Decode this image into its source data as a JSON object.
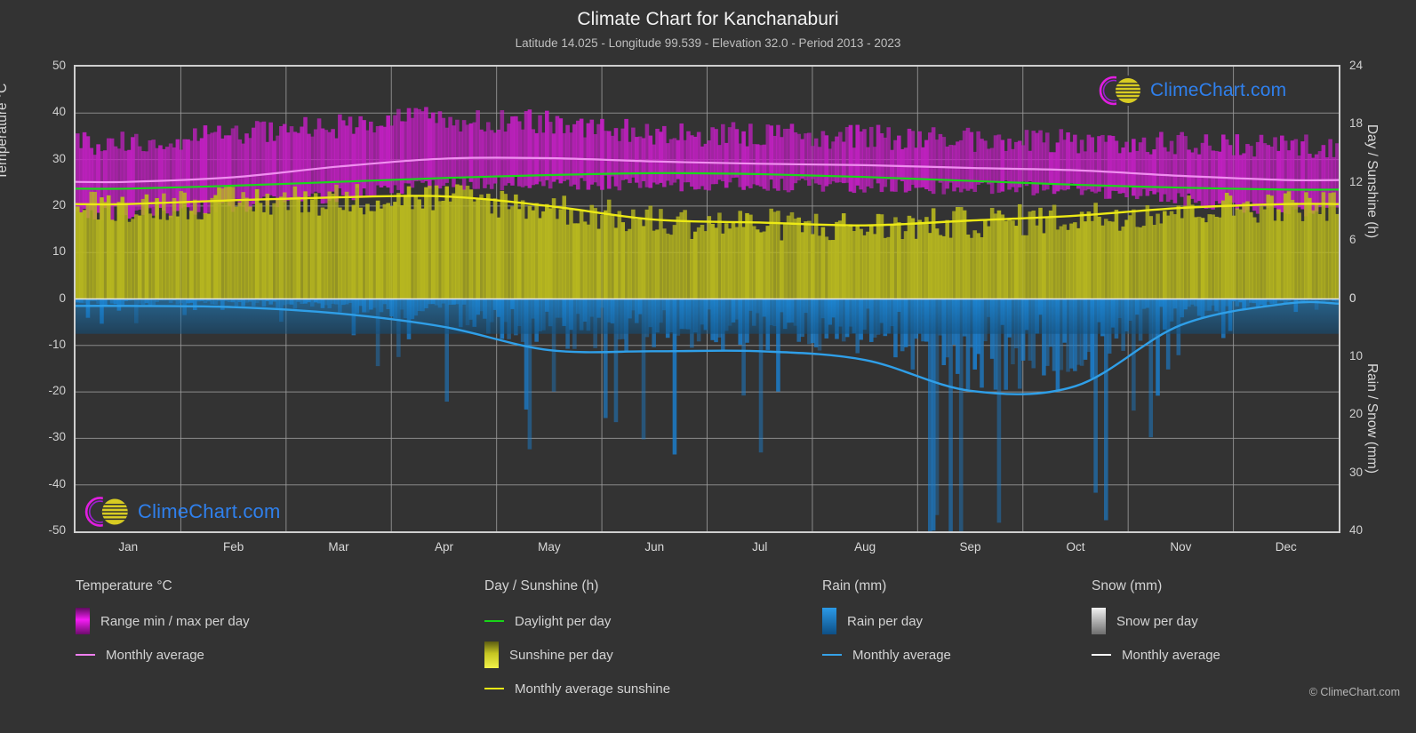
{
  "header": {
    "title": "Climate Chart for Kanchanaburi",
    "subtitle": "Latitude 14.025 - Longitude 99.539 - Elevation 32.0 - Period 2013 - 2023"
  },
  "axes": {
    "y_left_title": "Temperature °C",
    "y_right_top_title": "Day / Sunshine (h)",
    "y_right_bottom_title": "Rain / Snow (mm)",
    "y_left_ticks": [
      "50",
      "40",
      "30",
      "20",
      "10",
      "0",
      "-10",
      "-20",
      "-30",
      "-40",
      "-50"
    ],
    "y_right_top_ticks": [
      "24",
      "18",
      "12",
      "6",
      "0"
    ],
    "y_right_bottom_ticks": [
      "0",
      "10",
      "20",
      "30",
      "40"
    ],
    "x_ticks": [
      "Jan",
      "Feb",
      "Mar",
      "Apr",
      "May",
      "Jun",
      "Jul",
      "Aug",
      "Sep",
      "Oct",
      "Nov",
      "Dec"
    ]
  },
  "legend": {
    "temperature": {
      "heading": "Temperature °C",
      "items": [
        {
          "label": "Range min / max per day",
          "marker": "gradient-swatch",
          "color": "#c020c0"
        },
        {
          "label": "Monthly average",
          "marker": "line",
          "color": "#ef7fef"
        }
      ]
    },
    "day_sunshine": {
      "heading": "Day / Sunshine (h)",
      "items": [
        {
          "label": "Daylight per day",
          "marker": "line",
          "color": "#18d418"
        },
        {
          "label": "Sunshine per day",
          "marker": "gradient-swatch",
          "color": "#b8b820"
        },
        {
          "label": "Monthly average sunshine",
          "marker": "line",
          "color": "#e8e815"
        }
      ]
    },
    "rain": {
      "heading": "Rain (mm)",
      "items": [
        {
          "label": "Rain per day",
          "marker": "gradient-swatch",
          "color": "#1484d6"
        },
        {
          "label": "Monthly average",
          "marker": "line",
          "color": "#36a2e8"
        }
      ]
    },
    "snow": {
      "heading": "Snow (mm)",
      "items": [
        {
          "label": "Snow per day",
          "marker": "gradient-swatch",
          "color": "#cfcfcf"
        },
        {
          "label": "Monthly average",
          "marker": "line",
          "color": "#ffffff"
        }
      ]
    }
  },
  "logo": {
    "text": "ClimeChart.com"
  },
  "copyright": "© ClimeChart.com",
  "chart_data": {
    "type": "area",
    "title": "Climate Chart for Kanchanaburi",
    "subtitle": "Latitude 14.025 - Longitude 99.539 - Elevation 32.0 - Period 2013 - 2023",
    "xlabel": "",
    "ylabel": "Temperature °C",
    "ylabel_right_top": "Day / Sunshine (h)",
    "ylabel_right_bottom": "Rain / Snow (mm)",
    "ylim": [
      -50,
      50
    ],
    "ylim_right_top": [
      0,
      24
    ],
    "ylim_right_bottom": [
      0,
      40
    ],
    "grid": true,
    "legend_position": "below",
    "categories": [
      "Jan",
      "Feb",
      "Mar",
      "Apr",
      "May",
      "Jun",
      "Jul",
      "Aug",
      "Sep",
      "Oct",
      "Nov",
      "Dec"
    ],
    "series": [
      {
        "name": "Monthly average temperature",
        "unit": "°C",
        "axis": "left",
        "color": "#ef7fef",
        "values": [
          25.2,
          26.2,
          28.5,
          30.2,
          30.3,
          29.6,
          29.1,
          28.8,
          28.2,
          27.7,
          26.5,
          25.6
        ]
      },
      {
        "name": "Range max per day",
        "unit": "°C",
        "axis": "left",
        "color": "#c020c0",
        "values": [
          33.5,
          35.0,
          37.0,
          38.5,
          37.5,
          35.5,
          35.0,
          34.5,
          34.0,
          33.5,
          33.0,
          32.5
        ]
      },
      {
        "name": "Range min per day",
        "unit": "°C",
        "axis": "left",
        "color": "#c020c0",
        "values": [
          18.5,
          20.0,
          22.5,
          24.5,
          25.0,
          24.8,
          24.5,
          24.3,
          24.0,
          23.5,
          21.5,
          19.0
        ]
      },
      {
        "name": "Daylight per day",
        "unit": "h",
        "axis": "right_top",
        "color": "#18d418",
        "values": [
          11.4,
          11.7,
          12.1,
          12.5,
          12.8,
          13.0,
          12.9,
          12.6,
          12.2,
          11.8,
          11.5,
          11.3
        ]
      },
      {
        "name": "Monthly average sunshine",
        "unit": "h",
        "axis": "right_top",
        "color": "#e8e815",
        "values": [
          9.8,
          10.2,
          10.5,
          10.6,
          9.6,
          8.2,
          7.9,
          7.6,
          8.1,
          8.6,
          9.4,
          9.8
        ]
      },
      {
        "name": "Monthly average rain",
        "unit": "mm",
        "axis": "right_bottom",
        "color": "#36a2e8",
        "values": [
          1.2,
          1.4,
          2.5,
          4.8,
          8.8,
          9.0,
          9.0,
          10.5,
          15.8,
          15.0,
          4.5,
          0.8
        ]
      }
    ]
  }
}
